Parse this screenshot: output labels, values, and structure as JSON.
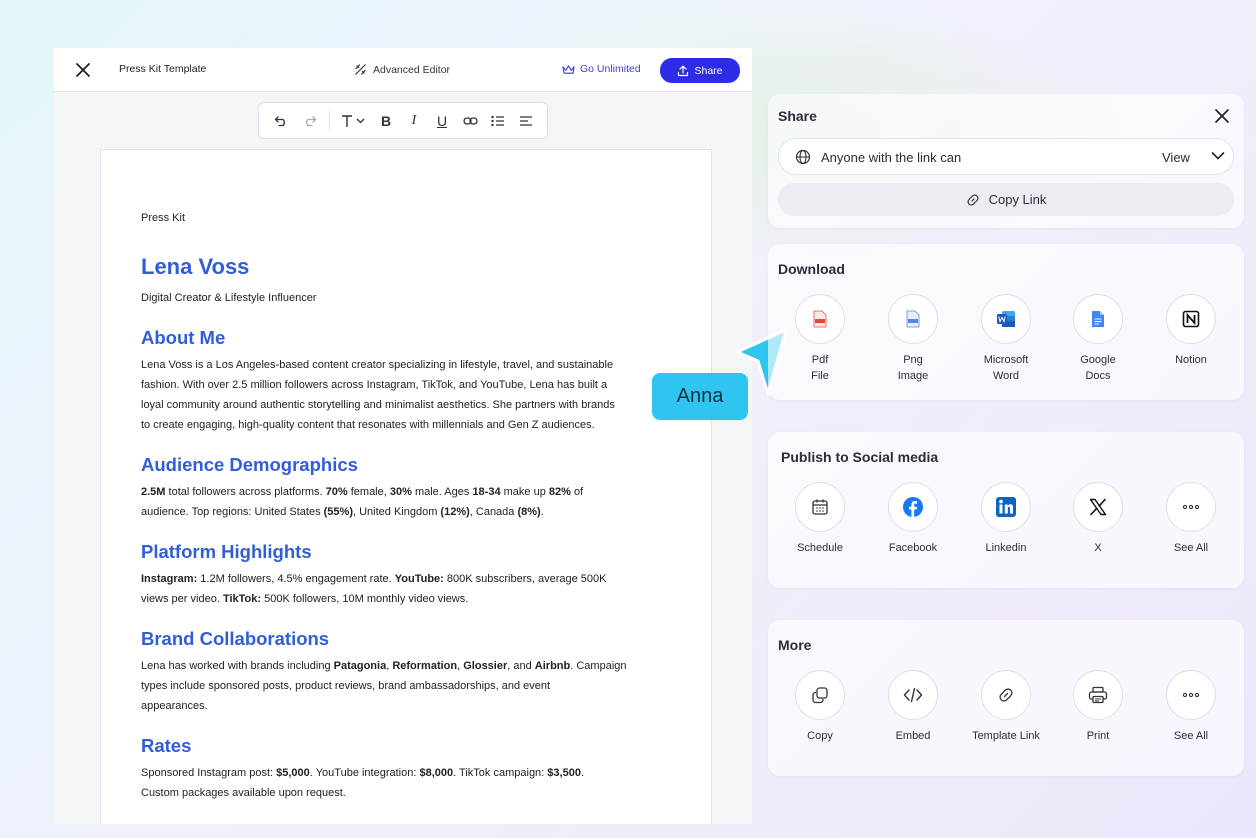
{
  "topbar": {
    "doc_title": "Press Kit Template",
    "advanced_editor": "Advanced Editor",
    "go_unlimited": "Go Unlimited",
    "share": "Share"
  },
  "toolbar": {
    "tools": [
      "undo-icon",
      "redo-icon",
      "text-style-icon",
      "bold-icon",
      "italic-icon",
      "underline-icon",
      "link-icon",
      "bullet-list-icon",
      "align-left-icon"
    ],
    "bold": "B",
    "italic": "I",
    "underline": "U"
  },
  "document": {
    "label": "Press Kit",
    "name": "Lena Voss",
    "tagline": "Digital Creator & Lifestyle Influencer",
    "about_heading": "About Me",
    "about_lines": [
      "Lena Voss is a Los Angeles-based content creator specializing in lifestyle, travel, and sustainable",
      "fashion. With over 2.5 million followers across Instagram, TikTok, and YouTube, Lena has built a",
      "loyal community around authentic storytelling and minimalist aesthetics. She partners with brands",
      "to create engaging, high-quality content that resonates with millennials and Gen Z audiences."
    ],
    "demographics_heading": "Audience Demographics",
    "demo": {
      "total": "2.5M",
      "t1": " total followers across platforms. ",
      "female_pct": "70%",
      "t2": " female, ",
      "male_pct": "30%",
      "t3": " male. Ages ",
      "ages": "18-34",
      "t4": " make up ",
      "ages_pct": "82%",
      "t5": " of",
      "t6": "audience. Top regions: United States ",
      "us_pct": "(55%)",
      "t7": ", United Kingdom ",
      "uk_pct": "(12%)",
      "t8": ", Canada ",
      "ca_pct": "(8%)",
      "t9": "."
    },
    "platform_heading": "Platform Highlights",
    "platform": {
      "ig_label": "Instagram:",
      "ig_text": " 1.2M followers, 4.5% engagement rate. ",
      "yt_label": "YouTube:",
      "yt_text": " 800K subscribers, average 500K",
      "t1": "views per video. ",
      "tt_label": "TikTok:",
      "tt_text": " 500K followers, 10M monthly video views."
    },
    "brands_heading": "Brand Collaborations",
    "brands": {
      "t1": "Lena has worked with brands including ",
      "b1": "Patagonia",
      "c1": ", ",
      "b2": "Reformation",
      "c2": ", ",
      "b3": "Glossier",
      "c3": ", and ",
      "b4": "Airbnb",
      "t2": ". Campaign",
      "line2": "types include sponsored posts, product reviews, brand ambassadorships, and event",
      "line3": "appearances."
    },
    "rates_heading": "Rates",
    "rates": {
      "t1": "Sponsored Instagram post: ",
      "v1": "$5,000",
      "t2": ". YouTube integration: ",
      "v2": "$8,000",
      "t3": ". TikTok campaign: ",
      "v3": "$3,500",
      "t4": ".",
      "line2": "Custom packages available upon request."
    }
  },
  "collaborator": {
    "name": "Anna",
    "color": "#2ec6f0"
  },
  "share_panel": {
    "title": "Share",
    "access_text": "Anyone with the link can",
    "permission": "View",
    "copy_link": "Copy Link"
  },
  "download_panel": {
    "title": "Download",
    "items": [
      {
        "label_1": "Pdf",
        "label_2": "File",
        "icon": "pdf-file-icon"
      },
      {
        "label_1": "Png",
        "label_2": "Image",
        "icon": "png-image-icon"
      },
      {
        "label_1": "Microsoft",
        "label_2": "Word",
        "icon": "microsoft-word-icon"
      },
      {
        "label_1": "Google",
        "label_2": "Docs",
        "icon": "google-docs-icon"
      },
      {
        "label_1": "Notion",
        "label_2": "",
        "icon": "notion-icon"
      }
    ]
  },
  "social_panel": {
    "title": "Publish to Social media",
    "items": [
      {
        "label": "Schedule",
        "icon": "calendar-icon"
      },
      {
        "label": "Facebook",
        "icon": "facebook-icon"
      },
      {
        "label": "Linkedin",
        "icon": "linkedin-icon"
      },
      {
        "label": "X",
        "icon": "x-icon"
      },
      {
        "label": "See All",
        "icon": "more-icon"
      }
    ]
  },
  "more_panel": {
    "title": "More",
    "items": [
      {
        "label": "Copy",
        "icon": "copy-icon"
      },
      {
        "label": "Embed",
        "icon": "code-icon"
      },
      {
        "label": "Template Link",
        "icon": "link-icon"
      },
      {
        "label": "Print",
        "icon": "printer-icon"
      },
      {
        "label": "See All",
        "icon": "more-icon"
      }
    ]
  },
  "colors": {
    "accent": "#2d2de6",
    "heading_blue": "#2f5ed8",
    "facebook": "#1877f2",
    "linkedin": "#0a66c2",
    "word": "#185abd",
    "docs": "#4285f4",
    "pdf": "#e2493b"
  }
}
